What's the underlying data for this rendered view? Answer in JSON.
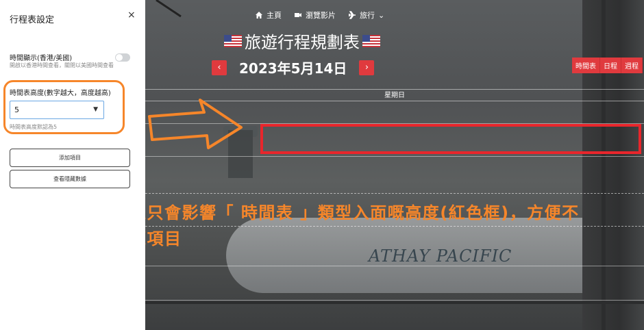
{
  "sidebar": {
    "title": "行程表設定",
    "close_glyph": "×",
    "time_display": {
      "label": "時間顯示(香港/美國)",
      "help": "開啟以香港時間查看，關閉以美國時間查看",
      "enabled": false
    },
    "timetable_height": {
      "label": "時間表高度(數字越大，高度越高)",
      "selected_value": "5",
      "help": "時間表高度默認為5"
    },
    "buttons": {
      "add_item": "添加項目",
      "view_hidden": "查看隱藏數據"
    }
  },
  "nav": {
    "home": "主頁",
    "videos": "瀏覽影片",
    "travel": "旅行",
    "travel_caret": "⌄"
  },
  "page": {
    "title": "旅遊行程規劃表",
    "date": "2023年5月14日",
    "prev_glyph": "‹",
    "next_glyph": "›",
    "view_tabs": [
      "時間表",
      "日程",
      "週程"
    ],
    "day_header": "星期日"
  },
  "annotation": {
    "caption": "時間表高度設定只會影響「 時間表 」類型入面嘅高度(紅色框)，方便不同裝置用戶瀏覽項目"
  },
  "background": {
    "plane_text": "ATHAY PACIFIC"
  },
  "colors": {
    "accent_red": "#e03a3e",
    "highlight_red": "#e8262c",
    "annotation_orange": "#f6862a"
  },
  "icons": [
    "home-icon",
    "video-icon",
    "plane-icon",
    "us-flag-icon",
    "chevron-down-icon",
    "close-icon"
  ]
}
